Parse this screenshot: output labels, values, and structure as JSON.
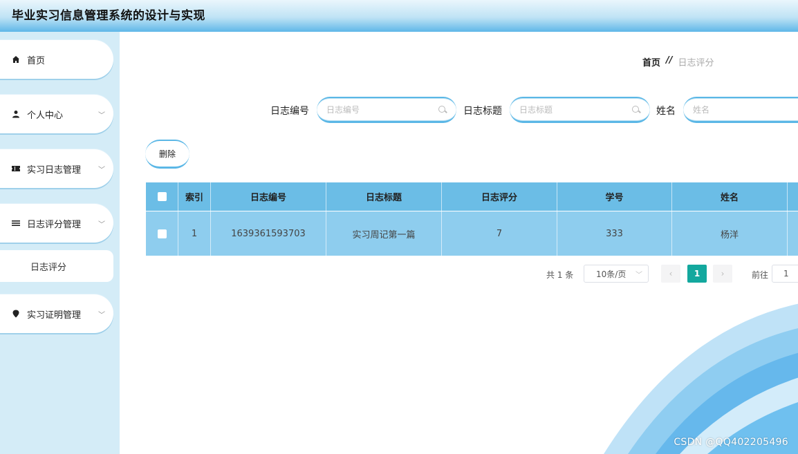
{
  "app": {
    "title": "毕业实习信息管理系统的设计与实现"
  },
  "sidebar": {
    "items": [
      {
        "label": "首页",
        "icon": "home-icon",
        "has_submenu": false
      },
      {
        "label": "个人中心",
        "icon": "user-icon",
        "has_submenu": true
      },
      {
        "label": "实习日志管理",
        "icon": "ticket-icon",
        "has_submenu": true
      },
      {
        "label": "日志评分管理",
        "icon": "list-icon",
        "has_submenu": true
      },
      {
        "label": "实习证明管理",
        "icon": "location-pin-icon",
        "has_submenu": true
      }
    ],
    "submenu": {
      "label": "日志评分"
    }
  },
  "breadcrumb": {
    "home": "首页",
    "separator": "//",
    "current": "日志评分"
  },
  "search": {
    "fields": [
      {
        "label": "日志编号",
        "placeholder": "日志编号"
      },
      {
        "label": "日志标题",
        "placeholder": "日志标题"
      },
      {
        "label": "姓名",
        "placeholder": "姓名"
      }
    ]
  },
  "toolbar": {
    "delete_label": "删除"
  },
  "table": {
    "columns": [
      "索引",
      "日志编号",
      "日志标题",
      "日志评分",
      "学号",
      "姓名"
    ],
    "rows": [
      {
        "index": "1",
        "log_no": "1639361593703",
        "log_title": "实习周记第一篇",
        "score": "7",
        "student_no": "333",
        "name": "杨洋"
      }
    ]
  },
  "pagination": {
    "total": "共 1 条",
    "page_size": "10条/页",
    "prev": "‹",
    "current_page": "1",
    "next": "›",
    "goto_label": "前往",
    "goto_value": "1"
  },
  "watermark": "CSDN @QQ402205496",
  "colors": {
    "accent": "#5bb7e6",
    "header_row": "#6bbde6",
    "data_row": "#8ecdee",
    "active_page": "#13a89e",
    "sidebar_bg": "#d4ecf7"
  }
}
